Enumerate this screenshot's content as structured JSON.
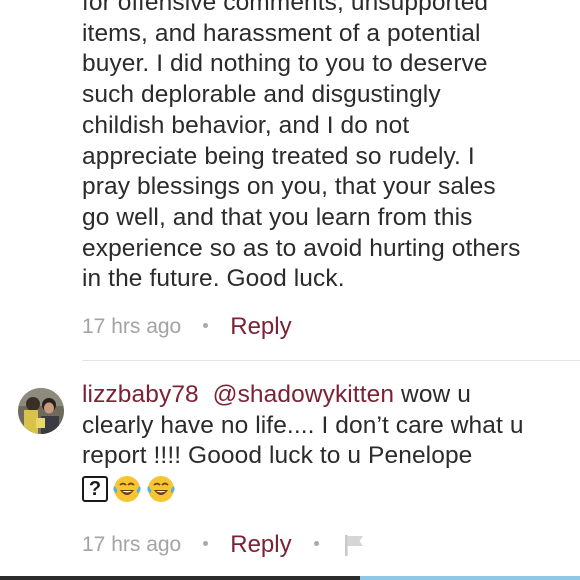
{
  "first_comment": {
    "lines": [
      "for offensive comments, unsupported",
      "items, and harassment of a potential",
      "buyer. I did nothing to you to deserve",
      "such deplorable and disgustingly",
      "childish behavior, and I do not",
      "appreciate being treated so rudely. I",
      "pray blessings on you, that your sales",
      "go well, and that you learn from this",
      "experience so as to avoid hurting others",
      "in the future. Good luck."
    ],
    "timestamp": "17 hrs ago",
    "reply_label": "Reply"
  },
  "second_comment": {
    "username": "lizzbaby78",
    "mention": "@shadowykitten",
    "line1_rest": " wow u",
    "line2": "clearly have no life.... I don’t care what u",
    "line3": "report !!!!  Goood luck to u Penelope",
    "unknown_glyph": "?",
    "timestamp": "17 hrs ago",
    "reply_label": "Reply"
  },
  "icons": {
    "avatar": "user-avatar",
    "emoji": "face-with-tears-of-joy-icon",
    "flag": "flag-icon"
  },
  "colors": {
    "accent": "#7b2234",
    "text": "#2b2b2b",
    "muted": "#9b9b9b",
    "divider": "#e3e3e3",
    "progress_active": "#8ec8e6"
  }
}
